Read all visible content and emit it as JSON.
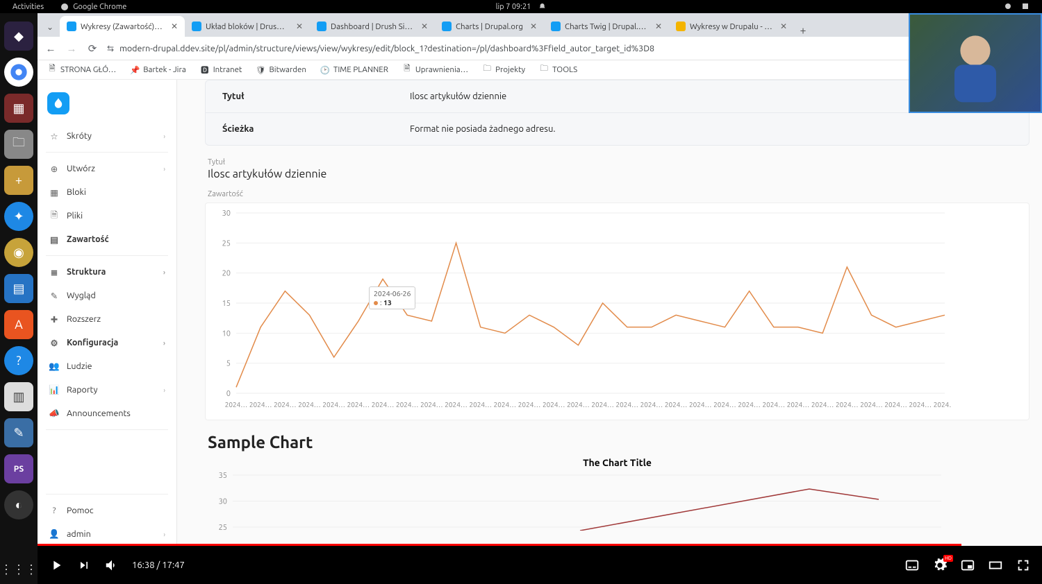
{
  "topbar": {
    "activities": "Activities",
    "app": "Google Chrome",
    "clock": "lip 7  09:21"
  },
  "tabs": [
    {
      "title": "Wykresy (Zawartość) | D",
      "active": true,
      "fav": "#139df4"
    },
    {
      "title": "Układ bloków | Drush Sit",
      "fav": "#139df4"
    },
    {
      "title": "Dashboard | Drush Site-",
      "fav": "#139df4"
    },
    {
      "title": "Charts | Drupal.org",
      "fav": "#139df4"
    },
    {
      "title": "Charts Twig | Drupal.org",
      "fav": "#139df4"
    },
    {
      "title": "Wykresy w Drupalu - Pre",
      "fav": "#f4b400"
    }
  ],
  "url": "modern-drupal.ddev.site/pl/admin/structure/views/view/wykresy/edit/block_1?destination=/pl/dashboard%3Ffield_autor_target_id%3D8",
  "bookmarks": [
    {
      "label": "STRONA GŁÓ…",
      "ic": ""
    },
    {
      "label": "Bartek - Jira",
      "ic": ""
    },
    {
      "label": "Intranet",
      "ic": ""
    },
    {
      "label": "Bitwarden",
      "ic": ""
    },
    {
      "label": "TIME PLANNER",
      "ic": ""
    },
    {
      "label": "Uprawnienia…",
      "ic": ""
    },
    {
      "label": "Projekty",
      "ic": ""
    },
    {
      "label": "TOOLS",
      "ic": ""
    }
  ],
  "sidebar": {
    "groups": [
      [
        {
          "label": "Skróty",
          "chev": true,
          "icon": "star"
        }
      ],
      [
        {
          "label": "Utwórz",
          "chev": true,
          "icon": "plus-circle"
        },
        {
          "label": "Bloki",
          "icon": "grid"
        },
        {
          "label": "Pliki",
          "icon": "file"
        },
        {
          "label": "Zawartość",
          "icon": "list",
          "bold": true
        }
      ],
      [
        {
          "label": "Struktura",
          "chev": true,
          "icon": "layers",
          "bold": true
        },
        {
          "label": "Wygląd",
          "icon": "brush"
        },
        {
          "label": "Rozszerz",
          "icon": "puzzle"
        },
        {
          "label": "Konfiguracja",
          "chev": true,
          "icon": "gear",
          "bold": true
        },
        {
          "label": "Ludzie",
          "icon": "users"
        },
        {
          "label": "Raporty",
          "chev": true,
          "icon": "chart"
        },
        {
          "label": "Announcements",
          "icon": "horn"
        }
      ],
      [
        {
          "label": "Pomoc",
          "icon": "help"
        },
        {
          "label": "admin",
          "chev": true,
          "icon": "user"
        }
      ]
    ]
  },
  "infocard": {
    "rows": [
      {
        "label": "Tytuł",
        "value": "Ilosc artykułów dziennie"
      },
      {
        "label": "Ścieżka",
        "value": "Format nie posiada żadnego adresu."
      }
    ]
  },
  "chart": {
    "section_label": "Tytuł",
    "section_title": "Ilosc artykułów dziennie",
    "content_label": "Zawartość",
    "sample_heading": "Sample Chart",
    "sample_title": "The Chart Title"
  },
  "chart_data": {
    "type": "line",
    "title": "Ilosc artykułów dziennie",
    "xlabel": "",
    "ylabel": "",
    "ylim": [
      0,
      30
    ],
    "yticks": [
      0,
      5,
      10,
      15,
      20,
      25,
      30
    ],
    "x_tick_label": "2024…",
    "x_count": 30,
    "tooltip": {
      "date": "2024-06-26",
      "value": 13,
      "index": 6
    },
    "series": [
      {
        "name": "",
        "color": "#e28b4a",
        "values": [
          1,
          11,
          17,
          13,
          6,
          12,
          19,
          13,
          12,
          25,
          11,
          10,
          13,
          11,
          8,
          15,
          11,
          11,
          13,
          12,
          11,
          17,
          11,
          11,
          10,
          21,
          13,
          11,
          12,
          13
        ]
      }
    ],
    "second_chart": {
      "type": "line",
      "title": "The Chart Title",
      "ylim": [
        25,
        35
      ],
      "yticks": [
        25,
        30,
        35
      ]
    }
  },
  "video": {
    "current": "16:38",
    "total": "17:47"
  }
}
